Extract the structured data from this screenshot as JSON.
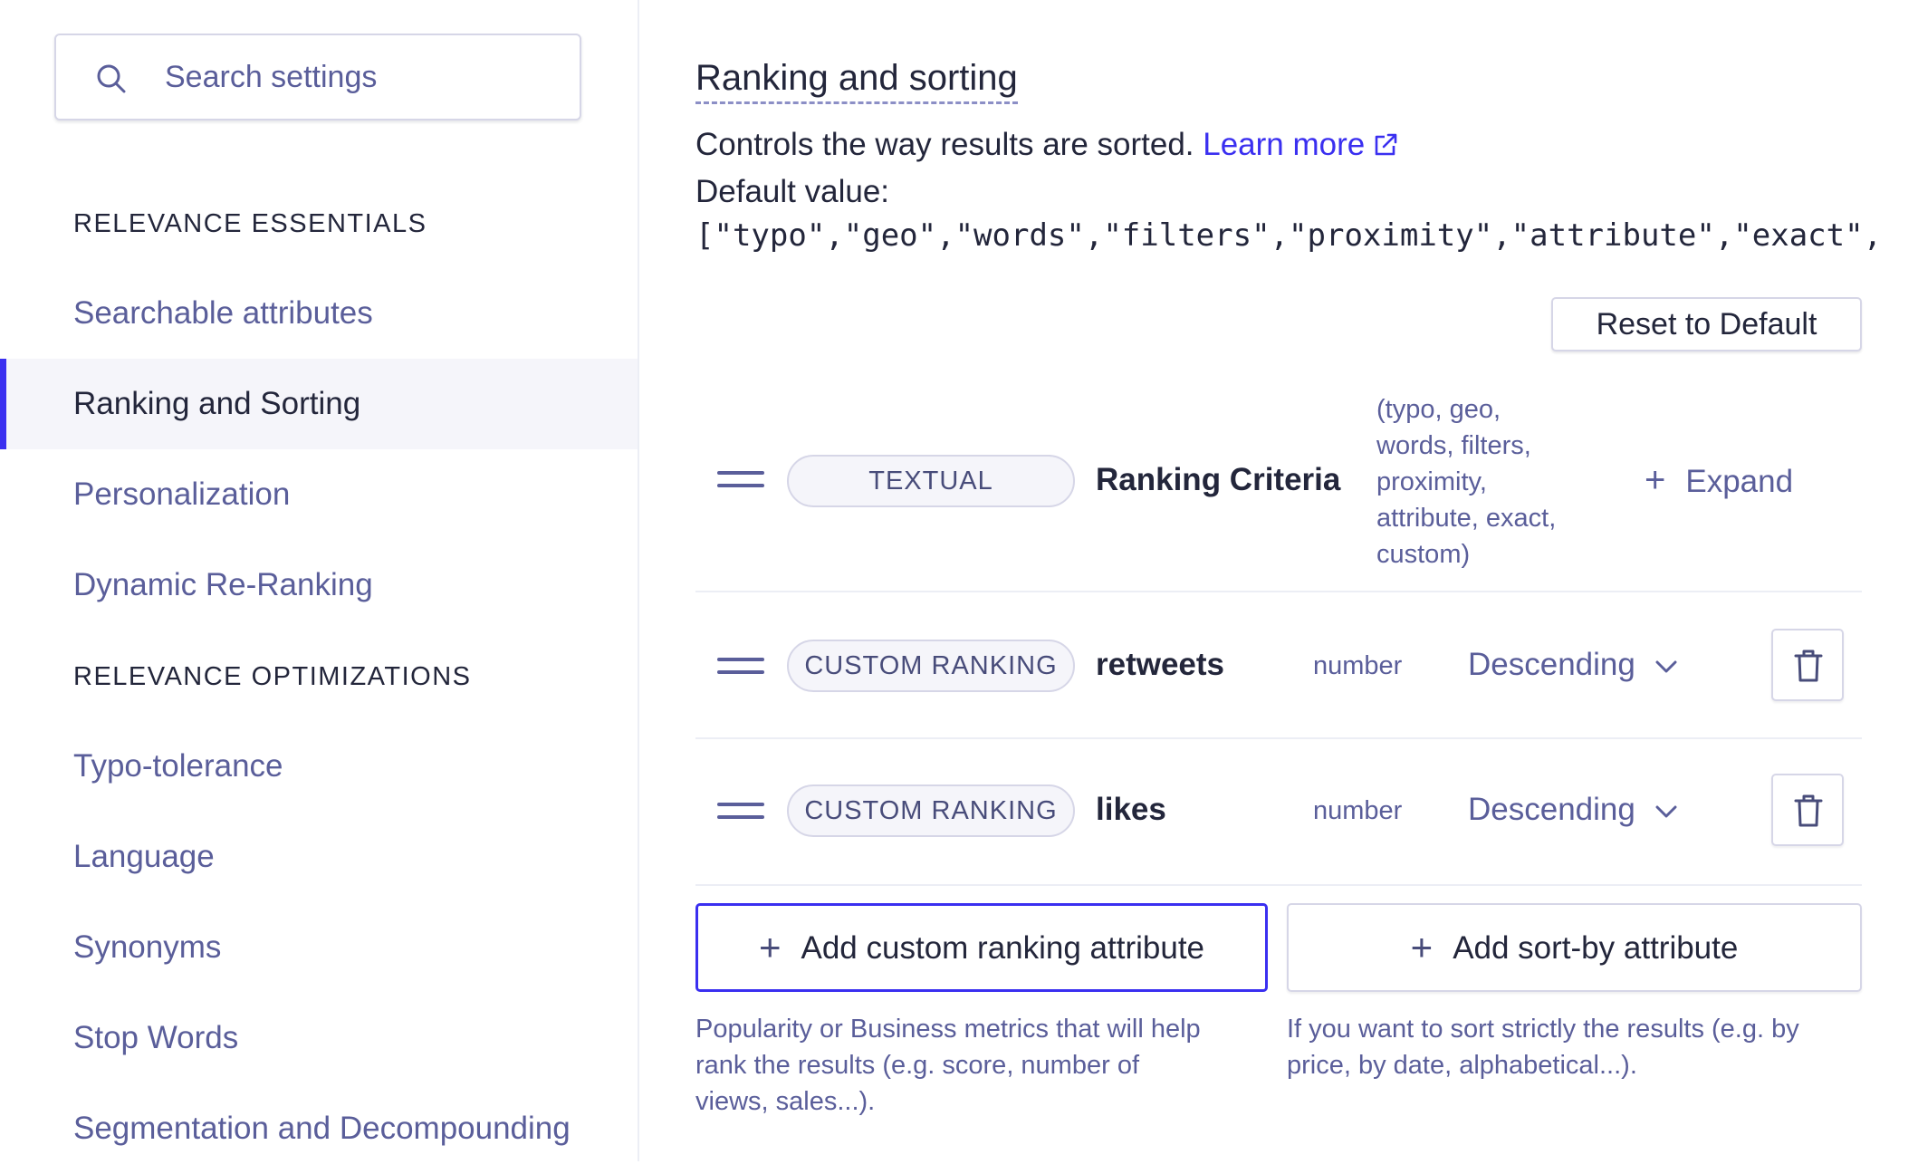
{
  "search": {
    "placeholder": "Search settings"
  },
  "sidebar": {
    "sections": [
      {
        "header": "RELEVANCE ESSENTIALS",
        "items": [
          {
            "label": "Searchable attributes"
          },
          {
            "label": "Ranking and Sorting",
            "active": true
          },
          {
            "label": "Personalization"
          },
          {
            "label": "Dynamic Re-Ranking"
          }
        ]
      },
      {
        "header": "RELEVANCE OPTIMIZATIONS",
        "items": [
          {
            "label": "Typo-tolerance"
          },
          {
            "label": "Language"
          },
          {
            "label": "Synonyms"
          },
          {
            "label": "Stop Words"
          },
          {
            "label": "Segmentation and Decompounding"
          }
        ]
      }
    ]
  },
  "main": {
    "title": "Ranking and sorting",
    "description": "Controls the way results are sorted.",
    "learn_more": "Learn more",
    "default_label": "Default value:",
    "default_value": "[\"typo\",\"geo\",\"words\",\"filters\",\"proximity\",\"attribute\",\"exact\",",
    "reset_label": "Reset to Default",
    "criteria_row": {
      "tag": "TEXTUAL",
      "name": "Ranking Criteria",
      "list_lines": [
        "(typo, geo,",
        "words, filters,",
        "proximity,",
        "attribute, exact,",
        "custom)"
      ],
      "expand_label": "Expand"
    },
    "ranking_rows": [
      {
        "tag": "CUSTOM RANKING",
        "name": "retweets",
        "type": "number",
        "order": "Descending"
      },
      {
        "tag": "CUSTOM RANKING",
        "name": "likes",
        "type": "number",
        "order": "Descending"
      }
    ],
    "add_custom": {
      "label": "Add custom ranking attribute",
      "help_lines": [
        "Popularity or Business metrics that will help",
        "rank the results (e.g. score, number of",
        "views, sales...)."
      ]
    },
    "add_sort": {
      "label": "Add sort-by attribute",
      "help_lines": [
        "If you want to sort strictly the results (e.g. by",
        "price, by date, alphabetical...)."
      ]
    }
  },
  "colors": {
    "accent": "#3a2ff0",
    "text": "#23263b",
    "muted": "#5a5e9a",
    "border": "#d6d6e7",
    "active_bg": "#f5f5fa"
  }
}
